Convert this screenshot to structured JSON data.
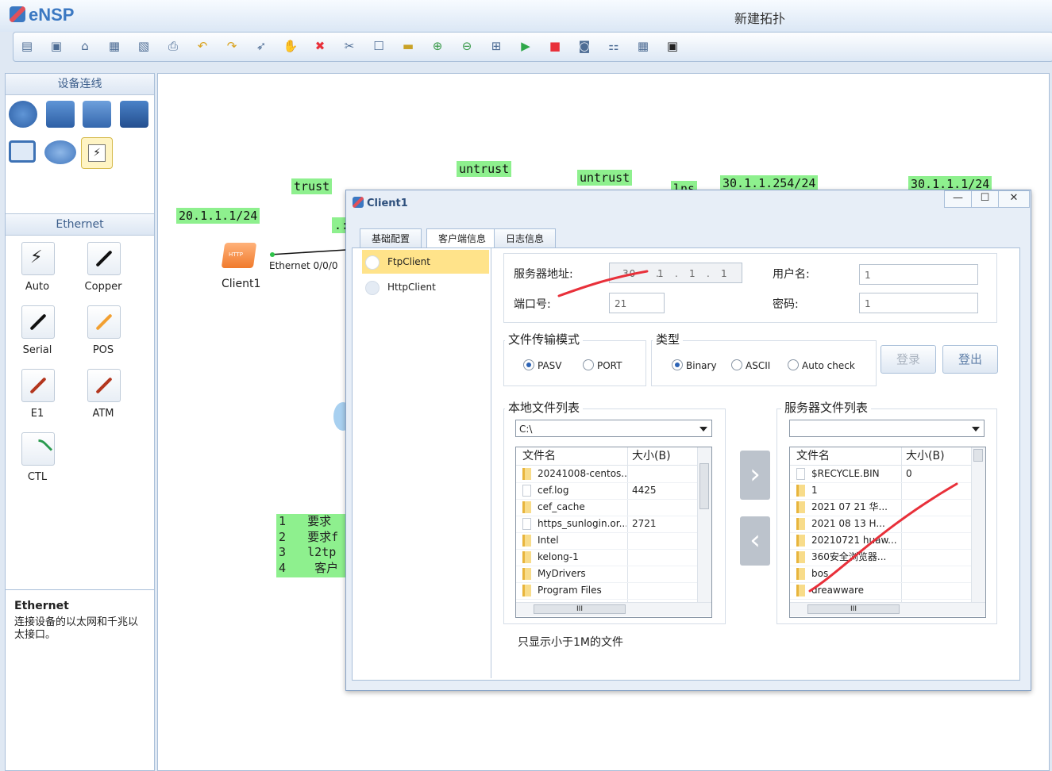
{
  "app": {
    "name": "eNSP",
    "window_title": "新建拓扑"
  },
  "toolbar": {
    "icons": [
      "new-topology-icon",
      "new-template-icon",
      "open-icon",
      "save-icon",
      "save-as-icon",
      "print-icon",
      "undo-icon",
      "redo-icon",
      "select-icon",
      "pan-hand-icon",
      "delete-icon",
      "delete-link-icon",
      "text-icon",
      "palette-icon",
      "zoom-in-icon",
      "zoom-out-icon",
      "fit-icon",
      "start-icon",
      "stop-icon",
      "capture-icon",
      "topology-icon",
      "grid-icon",
      "console-icon"
    ]
  },
  "left_panel": {
    "device_section": "设备连线",
    "ethernet_section": "Ethernet",
    "cables": [
      "Auto",
      "Copper",
      "Serial",
      "POS",
      "E1",
      "ATM",
      "CTL"
    ],
    "info_title": "Ethernet",
    "info_desc": "连接设备的以太网和千兆以太接口。"
  },
  "canvas": {
    "tags": {
      "ip_client": "20.1.1.1/24",
      "trust": "trust",
      "dot": ".:",
      "untrust1": "untrust",
      "untrust2": "untrust",
      "lns": "lns",
      "ip_lns": "30.1.1.254/24",
      "ip_server": "30.1.1.1/24"
    },
    "client_label": "Client1",
    "port_label": "Ethernet 0/0/0",
    "notes": [
      {
        "n": "1",
        "t": "要求"
      },
      {
        "n": "2",
        "t": "要求f"
      },
      {
        "n": "3",
        "t": "l2tp"
      },
      {
        "n": "4",
        "t": " 客户"
      }
    ]
  },
  "dialog": {
    "title": "Client1",
    "tabs": [
      "基础配置",
      "客户端信息",
      "日志信息"
    ],
    "side_items": [
      "FtpClient",
      "HttpClient"
    ],
    "server_addr_label": "服务器地址:",
    "server_addr": {
      "a": "30",
      "b": "1",
      "c": "1",
      "d": "1"
    },
    "port_label": "端口号:",
    "port_value": "21",
    "user_label": "用户名:",
    "user_value": "1",
    "pwd_label": "密码:",
    "pwd_value": "1",
    "mode_title": "文件传输模式",
    "mode_options": [
      "PASV",
      "PORT"
    ],
    "type_title": "类型",
    "type_options": [
      "Binary",
      "ASCII",
      "Auto check"
    ],
    "login_btn": "登录",
    "logout_btn": "登出",
    "local_title": "本地文件列表",
    "local_path": "C:\\",
    "server_title": "服务器文件列表",
    "server_path": "",
    "col_name": "文件名",
    "col_size": "大小(B)",
    "local_files": [
      {
        "name": "20241008-centos...",
        "size": "",
        "folder": true
      },
      {
        "name": "cef.log",
        "size": "4425",
        "folder": false
      },
      {
        "name": "cef_cache",
        "size": "",
        "folder": true
      },
      {
        "name": "https_sunlogin.or...",
        "size": "2721",
        "folder": false
      },
      {
        "name": "Intel",
        "size": "",
        "folder": true
      },
      {
        "name": "kelong-1",
        "size": "",
        "folder": true
      },
      {
        "name": "MyDrivers",
        "size": "",
        "folder": true
      },
      {
        "name": "Program Files",
        "size": "",
        "folder": true
      }
    ],
    "server_files": [
      {
        "name": "$RECYCLE.BIN",
        "size": "0",
        "folder": false
      },
      {
        "name": "1",
        "size": "",
        "folder": true
      },
      {
        "name": "2021 07  21  华...",
        "size": "",
        "folder": true
      },
      {
        "name": "2021 08 13     H...",
        "size": "",
        "folder": true
      },
      {
        "name": "20210721  huaw...",
        "size": "",
        "folder": true
      },
      {
        "name": "360安全浏览器...",
        "size": "",
        "folder": true
      },
      {
        "name": "bos",
        "size": "",
        "folder": true
      },
      {
        "name": "dreawware",
        "size": "",
        "folder": true
      }
    ],
    "note": "只显示小于1M的文件",
    "scroll_mark": "III",
    "arrow_right": "›",
    "arrow_left": "‹"
  },
  "colors": {
    "tag_green": "#8ef08e",
    "annotation_red": "#e8303a",
    "accent": "#3b78c2"
  }
}
